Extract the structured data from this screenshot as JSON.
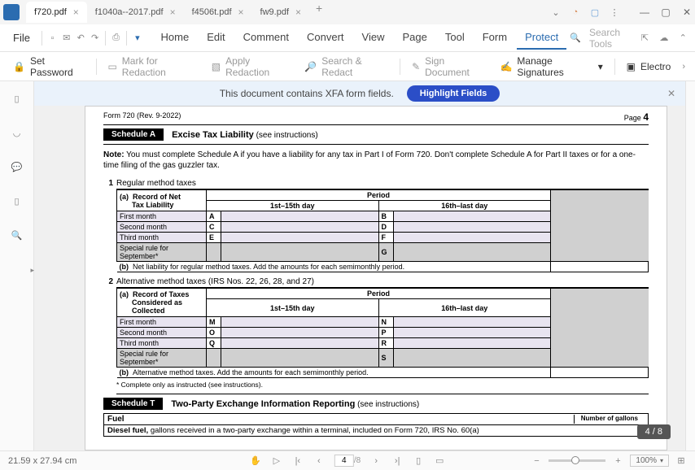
{
  "titlebar": {
    "tabs": [
      {
        "label": "f720.pdf",
        "active": true
      },
      {
        "label": "f1040a--2017.pdf",
        "active": false
      },
      {
        "label": "f4506t.pdf",
        "active": false
      },
      {
        "label": "fw9.pdf",
        "active": false
      }
    ]
  },
  "menubar": {
    "file": "File",
    "tabs": [
      "Home",
      "Edit",
      "Comment",
      "Convert",
      "View",
      "Page",
      "Tool",
      "Form",
      "Protect"
    ],
    "active_tab": "Protect",
    "search_placeholder": "Search Tools"
  },
  "toolbar": {
    "set_password": "Set Password",
    "mark_redaction": "Mark for Redaction",
    "apply_redaction": "Apply Redaction",
    "search_redact": "Search & Redact",
    "sign_document": "Sign Document",
    "manage_sig": "Manage Signatures",
    "electro": "Electro"
  },
  "banner": {
    "text": "This document contains XFA form fields.",
    "button": "Highlight Fields"
  },
  "form": {
    "header_left": "Form 720 (Rev. 9-2022)",
    "header_right_label": "Page",
    "header_right_num": "4",
    "schedA": {
      "tag": "Schedule A",
      "title": "Excise Tax Liability",
      "sub": "(see instructions)"
    },
    "note_label": "Note:",
    "note_text": "You must complete Schedule A if you have a liability for any tax in Part I of Form 720. Don't complete Schedule A for Part II taxes or for a one-time filing of the gas guzzler tax.",
    "sec1": {
      "num": "1",
      "title": "Regular method taxes",
      "a": "(a)",
      "a_label1": "Record of Net",
      "a_label2": "Tax Liability",
      "period": "Period",
      "col1": "1st–15th day",
      "col2": "16th–last day",
      "rows": [
        {
          "label": "First month",
          "l1": "A",
          "l2": "B"
        },
        {
          "label": "Second month",
          "l1": "C",
          "l2": "D"
        },
        {
          "label": "Third month",
          "l1": "E",
          "l2": "F"
        },
        {
          "label": "Special rule for September*",
          "l1": "",
          "l2": "G",
          "gray": true
        }
      ],
      "b": "(b)",
      "b_text": "Net liability for regular method taxes. Add the amounts for each semimonthly period."
    },
    "sec2": {
      "num": "2",
      "title": "Alternative method taxes (IRS Nos. 22, 26, 28, and 27)",
      "a": "(a)",
      "a_label1": "Record of Taxes",
      "a_label2": "Considered as",
      "a_label3": "Collected",
      "period": "Period",
      "col1": "1st–15th day",
      "col2": "16th–last day",
      "rows": [
        {
          "label": "First month",
          "l1": "M",
          "l2": "N"
        },
        {
          "label": "Second month",
          "l1": "O",
          "l2": "P"
        },
        {
          "label": "Third month",
          "l1": "Q",
          "l2": "R"
        },
        {
          "label": "Special rule for September*",
          "l1": "",
          "l2": "S",
          "gray": true
        }
      ],
      "b": "(b)",
      "b_text": "Alternative method taxes. Add the amounts for each semimonthly period."
    },
    "footnote": "* Complete only as instructed (see instructions).",
    "schedT": {
      "tag": "Schedule T",
      "title": "Two-Party Exchange Information Reporting",
      "sub": "(see instructions)"
    },
    "fuel": "Fuel",
    "num_gallons": "Number of gallons",
    "diesel_label": "Diesel fuel,",
    "diesel_text": "gallons received in a two-party exchange within a terminal, included on Form 720, IRS No. 60(a)"
  },
  "page_badge": "4 / 8",
  "statusbar": {
    "dims": "21.59 x 27.94 cm",
    "page_current": "4",
    "page_total": "/8",
    "zoom": "100%"
  }
}
